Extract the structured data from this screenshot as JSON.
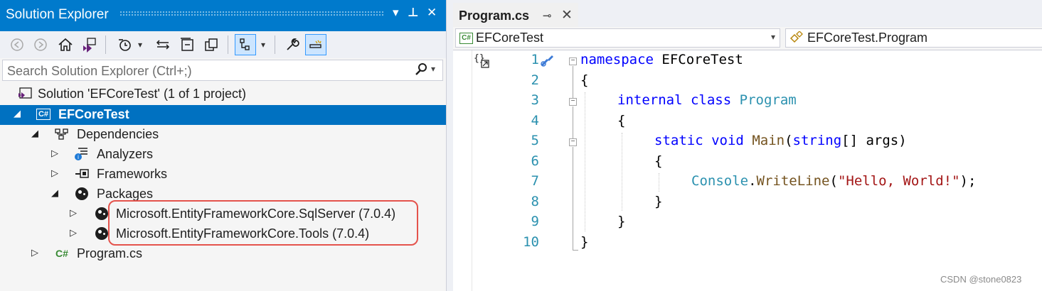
{
  "solution_explorer": {
    "title": "Solution Explorer",
    "controls": {
      "dropdown": "▾",
      "pin": "⊥",
      "close": "✕"
    },
    "toolbar": {
      "icons": [
        "back-icon",
        "forward-icon",
        "home-icon",
        "vs-solution-icon",
        "history-icon",
        "sync-icon",
        "collapse-all-icon",
        "copy-icon",
        "tree-view-icon",
        "properties-wrench-icon",
        "preview-icon"
      ]
    },
    "search": {
      "placeholder": "Search Solution Explorer (Ctrl+;)"
    },
    "tree": [
      {
        "label": "Solution 'EFCoreTest' (1 of 1 project)",
        "icon": "solution-icon"
      },
      {
        "label": "EFCoreTest",
        "icon": "csharp-project-icon",
        "badge": "C#",
        "selected": true
      },
      {
        "label": "Dependencies",
        "icon": "dependencies-icon"
      },
      {
        "label": "Analyzers",
        "icon": "analyzers-icon"
      },
      {
        "label": "Frameworks",
        "icon": "frameworks-icon"
      },
      {
        "label": "Packages",
        "icon": "package-icon"
      },
      {
        "label": "Microsoft.EntityFrameworkCore.SqlServer (7.0.4)",
        "icon": "package-icon"
      },
      {
        "label": "Microsoft.EntityFrameworkCore.Tools (7.0.4)",
        "icon": "package-icon"
      },
      {
        "label": "Program.cs",
        "icon": "csharp-file-icon",
        "badge": "C#"
      }
    ]
  },
  "editor": {
    "tab": {
      "label": "Program.cs",
      "pin": "⊸",
      "close": "✕"
    },
    "nav": {
      "project": "EFCoreTest",
      "class": "EFCoreTest.Program"
    },
    "line_numbers": [
      "1",
      "2",
      "3",
      "4",
      "5",
      "6",
      "7",
      "8",
      "9",
      "10"
    ],
    "code": {
      "l1_kw": "namespace",
      "l1_rest": " EFCoreTest",
      "l2": "{",
      "l3_kw1": "internal",
      "l3_kw2": "class",
      "l3_type": "Program",
      "l4": "{",
      "l5_kw1": "static",
      "l5_kw2": "void",
      "l5_method": "Main",
      "l5_p1": "(",
      "l5_kw3": "string",
      "l5_p2": "[] args)",
      "l6": "{",
      "l7_type": "Console",
      "l7_dot": ".",
      "l7_method": "WriteLine",
      "l7_p1": "(",
      "l7_str": "\"Hello, World!\"",
      "l7_p2": ");",
      "l8": "}",
      "l9": "}",
      "l10": "}"
    }
  },
  "watermark": "CSDN @stone0823"
}
